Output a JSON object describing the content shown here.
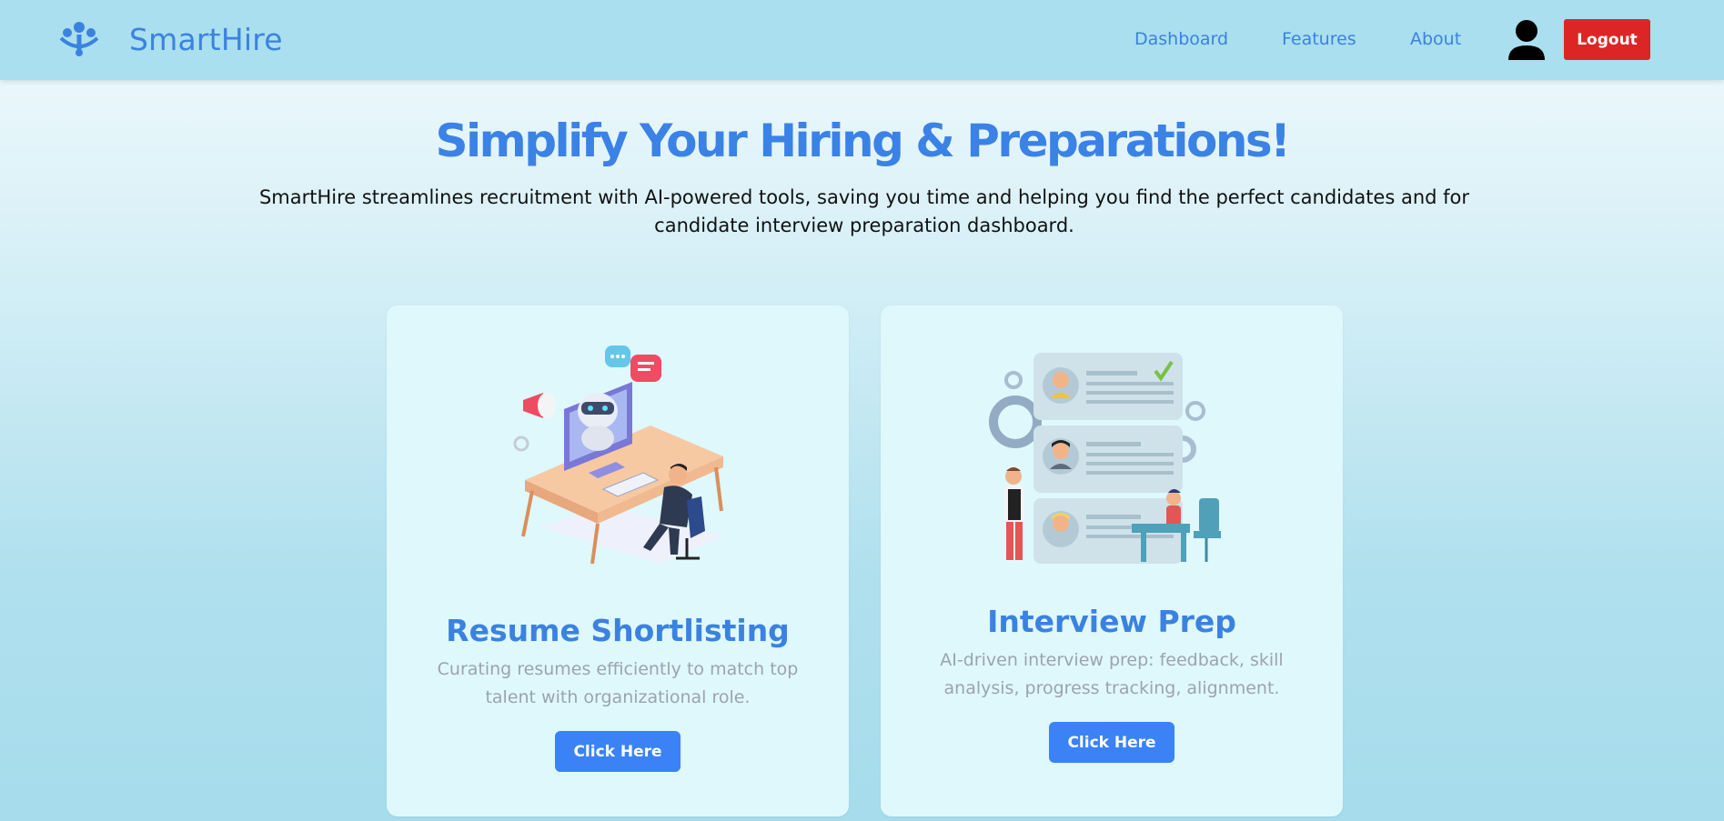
{
  "navbar": {
    "brand": "SmartHire",
    "logo_icon": "people-network-icon",
    "links": [
      "Dashboard",
      "Features",
      "About"
    ],
    "avatar_icon": "user-avatar-icon",
    "logout_label": "Logout"
  },
  "hero": {
    "title": "Simplify Your Hiring & Preparations!",
    "subtitle": "SmartHire streamlines recruitment with AI-powered tools, saving you time and helping you find the perfect candidates and for candidate interview preparation dashboard."
  },
  "cards": [
    {
      "illustration": "robot-at-desk-illustration",
      "title": "Resume Shortlisting",
      "description": "Curating resumes efficiently to match top talent with organizational role.",
      "button_label": "Click Here"
    },
    {
      "illustration": "candidate-profiles-illustration",
      "title": "Interview Prep",
      "description": "AI-driven interview prep: feedback, skill analysis, progress tracking, alignment.",
      "button_label": "Click Here"
    }
  ],
  "colors": {
    "accent": "#3b82e0",
    "logout": "#dc2626",
    "navbar": "#a9dfee",
    "card": "#dff8fc"
  }
}
